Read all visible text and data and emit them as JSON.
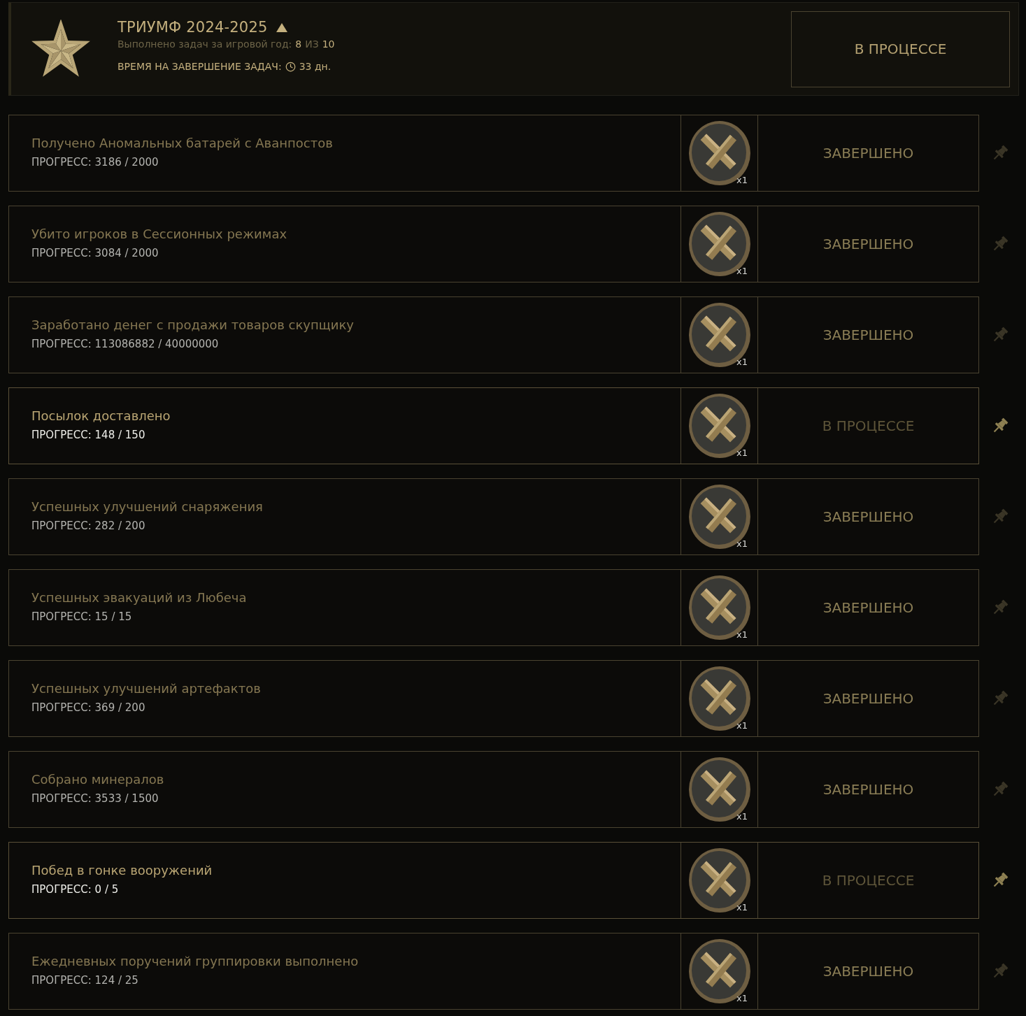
{
  "header": {
    "title": "ТРИУМФ 2024-2025",
    "expanded": true,
    "completed_label": "Выполнено задач за игровой год:",
    "completed": "8",
    "of": "ИЗ",
    "total": "10",
    "time_label": "ВРЕМЯ НА ЗАВЕРШЕНИЕ ЗАДАЧ:",
    "time_left": "33 дн.",
    "status": "В ПРОЦЕССЕ"
  },
  "tasks": [
    {
      "title": "Получено Аномальных батарей с Аванпостов",
      "progress": "ПРОГРЕСС: 3186 / 2000",
      "reward_count": "x1",
      "status": "ЗАВЕРШЕНО",
      "completed": true
    },
    {
      "title": "Убито игроков в Сессионных режимах",
      "progress": "ПРОГРЕСС: 3084 / 2000",
      "reward_count": "x1",
      "status": "ЗАВЕРШЕНО",
      "completed": true
    },
    {
      "title": "Заработано денег с продажи товаров скупщику",
      "progress": "ПРОГРЕСС: 113086882 / 40000000",
      "reward_count": "x1",
      "status": "ЗАВЕРШЕНО",
      "completed": true
    },
    {
      "title": "Посылок доставлено",
      "progress": "ПРОГРЕСС: 148 / 150",
      "reward_count": "x1",
      "status": "В ПРОЦЕССЕ",
      "completed": false
    },
    {
      "title": "Успешных улучшений снаряжения",
      "progress": "ПРОГРЕСС: 282 / 200",
      "reward_count": "x1",
      "status": "ЗАВЕРШЕНО",
      "completed": true
    },
    {
      "title": "Успешных эвакуаций из Любеча",
      "progress": "ПРОГРЕСС: 15 / 15",
      "reward_count": "x1",
      "status": "ЗАВЕРШЕНО",
      "completed": true
    },
    {
      "title": "Успешных улучшений артефактов",
      "progress": "ПРОГРЕСС: 369 / 200",
      "reward_count": "x1",
      "status": "ЗАВЕРШЕНО",
      "completed": true
    },
    {
      "title": "Собрано минералов",
      "progress": "ПРОГРЕСС: 3533 / 1500",
      "reward_count": "x1",
      "status": "ЗАВЕРШЕНО",
      "completed": true
    },
    {
      "title": "Побед в гонке вооружений",
      "progress": "ПРОГРЕСС: 0 / 5",
      "reward_count": "x1",
      "status": "В ПРОЦЕССЕ",
      "completed": false
    },
    {
      "title": "Ежедневных поручений группировки выполнено",
      "progress": "ПРОГРЕСС: 124 / 25",
      "reward_count": "x1",
      "status": "ЗАВЕРШЕНО",
      "completed": true
    }
  ]
}
